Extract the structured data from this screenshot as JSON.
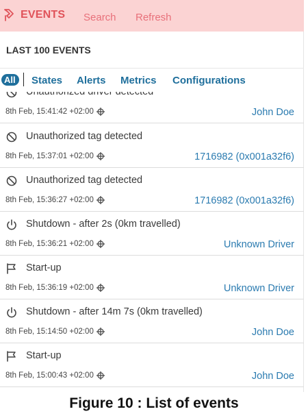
{
  "header": {
    "title": "EVENTS",
    "search_label": "Search",
    "refresh_label": "Refresh"
  },
  "subheader": {
    "title": "LAST 100 EVENTS"
  },
  "tabs": [
    {
      "label": "All",
      "selected": true
    },
    {
      "label": "States",
      "selected": false
    },
    {
      "label": "Alerts",
      "selected": false
    },
    {
      "label": "Metrics",
      "selected": false
    },
    {
      "label": "Configurations",
      "selected": false
    }
  ],
  "events": [
    {
      "icon": "prohibited-icon",
      "title": "Unauthorized driver detected",
      "time": "8th Feb, 15:41:42 +02:00",
      "who": "John Doe"
    },
    {
      "icon": "prohibited-icon",
      "title": "Unauthorized tag detected",
      "time": "8th Feb, 15:37:01 +02:00",
      "who": "1716982 (0x001a32f6)"
    },
    {
      "icon": "prohibited-icon",
      "title": "Unauthorized tag detected",
      "time": "8th Feb, 15:36:27 +02:00",
      "who": "1716982 (0x001a32f6)"
    },
    {
      "icon": "power-icon",
      "title": "Shutdown - after 2s (0km travelled)",
      "time": "8th Feb, 15:36:21 +02:00",
      "who": "Unknown Driver"
    },
    {
      "icon": "flag-icon",
      "title": "Start-up",
      "time": "8th Feb, 15:36:19 +02:00",
      "who": "Unknown Driver"
    },
    {
      "icon": "power-icon",
      "title": "Shutdown - after 14m 7s (0km travelled)",
      "time": "8th Feb, 15:14:50 +02:00",
      "who": "John Doe"
    },
    {
      "icon": "flag-icon",
      "title": "Start-up",
      "time": "8th Feb, 15:00:43 +02:00",
      "who": "John Doe"
    }
  ],
  "caption": "Figure 10 : List of events",
  "colors": {
    "header_bg": "#fbd3d3",
    "header_accent": "#e0535a",
    "link_blue": "#1f6f9c",
    "who_blue": "#2b7bb0"
  }
}
